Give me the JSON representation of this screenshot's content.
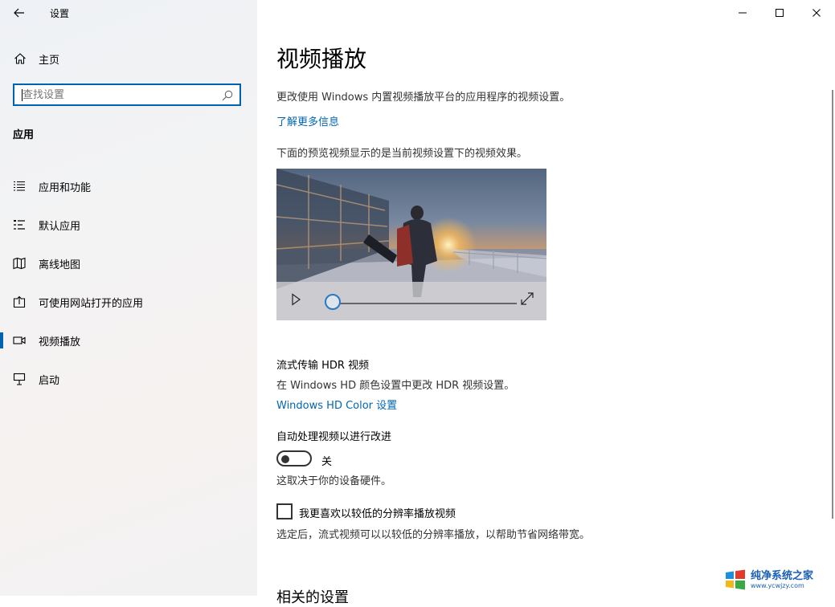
{
  "app": {
    "title": "设置"
  },
  "sidebar": {
    "home_label": "主页",
    "search_placeholder": "查找设置",
    "section_title": "应用",
    "items": [
      {
        "label": "应用和功能",
        "icon": "apps-list-icon"
      },
      {
        "label": "默认应用",
        "icon": "default-apps-icon"
      },
      {
        "label": "离线地图",
        "icon": "map-icon"
      },
      {
        "label": "可使用网站打开的应用",
        "icon": "open-in-app-icon"
      },
      {
        "label": "视频播放",
        "icon": "video-icon",
        "selected": true
      },
      {
        "label": "启动",
        "icon": "startup-icon"
      }
    ]
  },
  "main": {
    "title": "视频播放",
    "description": "更改使用 Windows 内置视频播放平台的应用程序的视频设置。",
    "learn_more": "了解更多信息",
    "preview_desc": "下面的预览视频显示的是当前视频设置下的视频效果。",
    "video": {
      "progress": 0.0
    },
    "hdr": {
      "title": "流式传输 HDR 视频",
      "desc": "在 Windows HD 颜色设置中更改 HDR 视频设置。",
      "link": "Windows HD Color 设置"
    },
    "auto_process": {
      "title": "自动处理视频以进行改进",
      "toggle_state": "关",
      "note": "这取决于你的设备硬件。"
    },
    "low_res": {
      "label": "我更喜欢以较低的分辨率播放视频",
      "desc": "选定后，流式视频可以以较低的分辨率播放，以帮助节省网络带宽。"
    },
    "related_title": "相关的设置"
  },
  "watermark": {
    "title": "纯净系统之家",
    "url": "www.ycwjzy.com"
  },
  "colors": {
    "accent": "#0063b1",
    "link": "#0066b4"
  }
}
